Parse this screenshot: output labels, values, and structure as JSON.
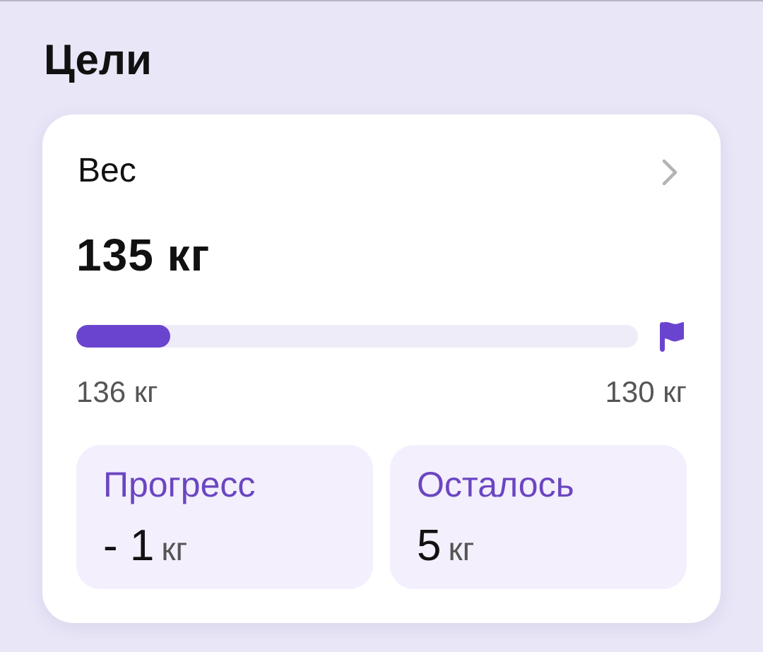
{
  "section": {
    "title": "Цели"
  },
  "goal_card": {
    "title": "Вес",
    "current": "135 кг",
    "progress_fraction": 0.167,
    "start_label": "136 кг",
    "target_label": "130 кг",
    "icons": {
      "open": "chevron-right-icon",
      "target": "flag-icon"
    },
    "colors": {
      "accent": "#6a44cf",
      "track": "#efecf9",
      "stat_bg": "#f3effd"
    },
    "stats": {
      "progress": {
        "label": "Прогресс",
        "value": "- 1",
        "unit": "кг"
      },
      "remaining": {
        "label": "Осталось",
        "value": "5",
        "unit": "кг"
      }
    }
  }
}
